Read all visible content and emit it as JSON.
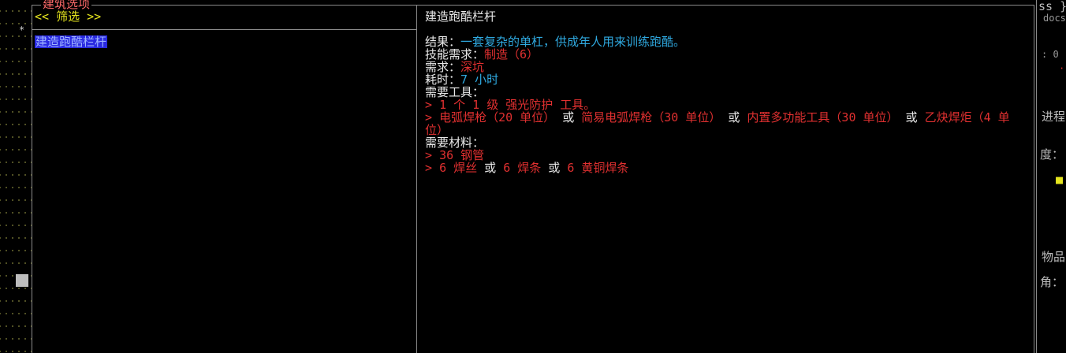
{
  "window": {
    "title": "建筑选项"
  },
  "filter": {
    "label": "<< 筛选 >>"
  },
  "list": {
    "items": [
      {
        "label": "建造跑酷栏杆",
        "selected": true
      }
    ]
  },
  "detail": {
    "title": "建造跑酷栏杆",
    "result_label": "结果：",
    "result_text": "一套复杂的单杠，供成年人用来训练跑酷。",
    "skill_label": "技能需求：",
    "skill_value": "制造（6）",
    "requires_label": "需求：",
    "requires_value": "深坑",
    "time_label": "耗时：",
    "time_value": "7 小时",
    "tools_label": "需要工具：",
    "tools": [
      {
        "bullet": ">",
        "items": [
          "1 个 1 级 强光防护 工具。"
        ],
        "sep": ""
      },
      {
        "bullet": ">",
        "items": [
          "电弧焊枪（20 单位）",
          "简易电弧焊枪（30 单位）",
          "内置多功能工具（30 单位）",
          "乙炔焊炬（4 单位）"
        ],
        "sep": "或"
      }
    ],
    "materials_label": "需要材料：",
    "materials": [
      {
        "bullet": ">",
        "items": [
          "36 钢管"
        ],
        "sep": ""
      },
      {
        "bullet": ">",
        "items": [
          "6 焊丝",
          "6 焊条",
          "6 黄铜焊条"
        ],
        "sep": "或"
      }
    ]
  },
  "sidebar": {
    "top_text": "ss }",
    "docs_text": "docs",
    "zero_text": ": 0",
    "progress_text": "进程",
    "degree_text": "度：",
    "items_text": "物品",
    "corner_text": "角："
  },
  "colors": {
    "accent_cyan": "#2fa9e0",
    "accent_red": "#e03030",
    "filter_yellow": "#e6e61e",
    "selection_blue": "#2a2ae0"
  }
}
